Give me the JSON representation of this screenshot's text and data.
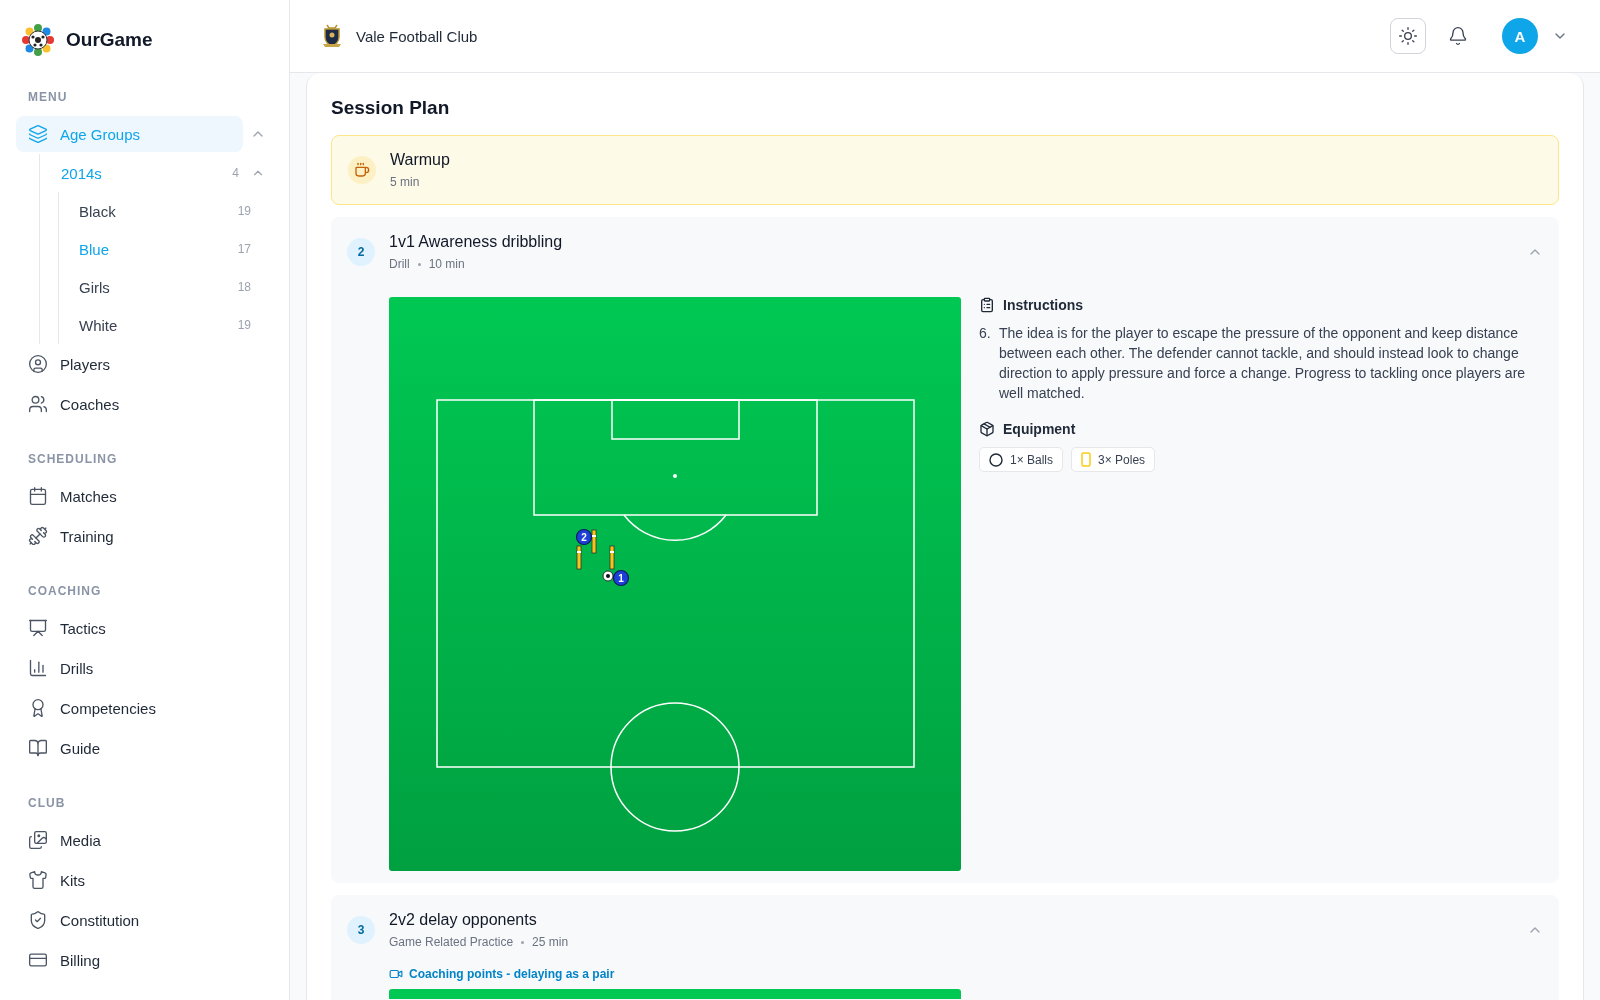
{
  "app": {
    "name": "OurGame"
  },
  "sidebar": {
    "sections": [
      {
        "title": "MENU",
        "items": [
          {
            "label": "Age Groups",
            "selected": true,
            "expanded": true,
            "children": [
              {
                "label": "2014s",
                "count": "4",
                "selected": true,
                "expanded": true,
                "children": [
                  {
                    "label": "Black",
                    "count": "19",
                    "selected": false
                  },
                  {
                    "label": "Blue",
                    "count": "17",
                    "selected": true
                  },
                  {
                    "label": "Girls",
                    "count": "18",
                    "selected": false
                  },
                  {
                    "label": "White",
                    "count": "19",
                    "selected": false
                  }
                ]
              }
            ]
          },
          {
            "label": "Players",
            "selected": false
          },
          {
            "label": "Coaches",
            "selected": false
          }
        ]
      },
      {
        "title": "SCHEDULING",
        "items": [
          {
            "label": "Matches",
            "selected": false
          },
          {
            "label": "Training",
            "selected": false
          }
        ]
      },
      {
        "title": "COACHING",
        "items": [
          {
            "label": "Tactics",
            "selected": false
          },
          {
            "label": "Drills",
            "selected": false
          },
          {
            "label": "Competencies",
            "selected": false
          },
          {
            "label": "Guide",
            "selected": false
          }
        ]
      },
      {
        "title": "CLUB",
        "items": [
          {
            "label": "Media",
            "selected": false
          },
          {
            "label": "Kits",
            "selected": false
          },
          {
            "label": "Constitution",
            "selected": false
          },
          {
            "label": "Billing",
            "selected": false
          }
        ]
      }
    ]
  },
  "header": {
    "club": "Vale Football Club",
    "avatar": "A"
  },
  "session": {
    "title": "Session Plan",
    "blocks": [
      {
        "kind": "warmup",
        "title": "Warmup",
        "duration": "5 min"
      },
      {
        "kind": "drill",
        "number": "2",
        "title": "1v1 Awareness dribbling",
        "type": "Drill",
        "duration": "10 min",
        "expanded": true,
        "diagram": {
          "kind": "pitch",
          "players": [
            "2",
            "1"
          ]
        },
        "instructions": {
          "title": "Instructions",
          "steps": [
            {
              "number": "6.",
              "text": "The idea is for the player to escape the pressure of the opponent and keep distance between each other. The defender cannot tackle, and should instead look to change direction to apply pressure and force a change. Progress to tackling once players are well matched."
            }
          ]
        },
        "equipment": {
          "title": "Equipment",
          "items": [
            {
              "kind": "ball",
              "label": "1× Balls"
            },
            {
              "kind": "pole",
              "label": "3× Poles"
            }
          ]
        }
      },
      {
        "kind": "drill",
        "number": "3",
        "title": "2v2 delay opponents",
        "type": "Game Related Practice",
        "duration": "25 min",
        "expanded": true,
        "link": "Coaching points - delaying as a pair",
        "diagram": {
          "kind": "pitch"
        }
      }
    ]
  }
}
